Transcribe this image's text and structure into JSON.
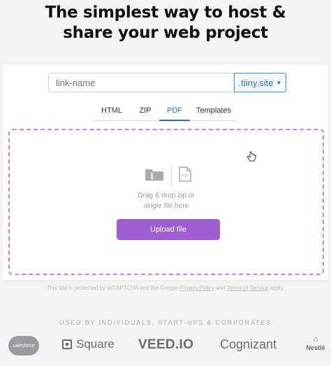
{
  "hero": {
    "line1": "The simplest way to host &",
    "line2": "share your web project"
  },
  "uploader": {
    "link_placeholder": "link-name",
    "domain": ".tiiny.site",
    "domain_icon": "caret-down-icon",
    "tabs": [
      {
        "label": "HTML",
        "active": false
      },
      {
        "label": "ZIP",
        "active": false
      },
      {
        "label": "PDF",
        "active": true
      },
      {
        "label": "Templates",
        "active": false
      }
    ],
    "drop_text_line1": "Drag & drop zip or",
    "drop_text_line2": "single file here",
    "upload_label": "Upload file",
    "icons": [
      "zip-file-icon",
      "pdf-file-icon"
    ],
    "pdf_icon_text": "PDF",
    "accent_color": "#a05ed4",
    "tab_active_color": "#2d6fb8"
  },
  "recaptcha": {
    "prefix": "This site is protected by reCAPTCHA and the Google ",
    "privacy": "Privacy Policy",
    "and": " and ",
    "terms": "Terms of Service",
    "suffix": " apply."
  },
  "clients": {
    "heading": "USED BY INDIVIDUALS, START-UPS & CORPORATES",
    "logos": [
      "salesforce",
      "Square",
      "VEED.IO",
      "Cognizant",
      "Nestlé"
    ]
  }
}
